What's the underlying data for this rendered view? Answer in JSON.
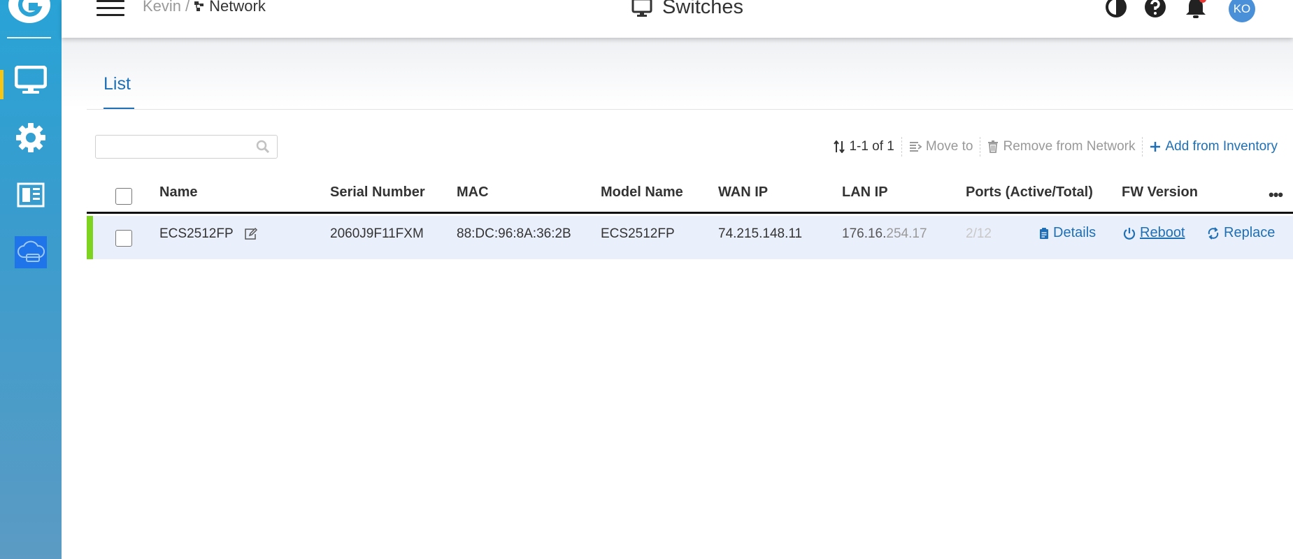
{
  "header": {
    "breadcrumb_parent": "Kevin",
    "breadcrumb_separator": "/",
    "breadcrumb_current": "Network",
    "title": "Switches",
    "avatar_initials": "KO"
  },
  "tabs": [
    {
      "label": "List",
      "active": true
    }
  ],
  "search": {
    "value": "",
    "placeholder": ""
  },
  "toolbar": {
    "count": "1-1 of 1",
    "move_to": "Move to",
    "remove": "Remove from Network",
    "add": "Add from Inventory"
  },
  "table": {
    "columns": [
      "Name",
      "Serial Number",
      "MAC",
      "Model Name",
      "WAN IP",
      "LAN IP",
      "Ports (Active/Total)",
      "FW Version"
    ],
    "rows": [
      {
        "name": "ECS2512FP",
        "serial": "2060J9F11FXM",
        "mac": "88:DC:96:8A:36:2B",
        "model": "ECS2512FP",
        "wan_ip": "74.215.148.11",
        "lan_ip_a": "176.16.",
        "lan_ip_b": "254.17",
        "ports": "2/12",
        "status": "online",
        "actions": {
          "details": "Details",
          "reboot": "Reboot",
          "replace": "Replace"
        }
      }
    ]
  },
  "colors": {
    "accent": "#1e6fb5",
    "status_online": "#7ed321",
    "sidebar_active": "#f5c518",
    "row_selected": "#e9effb"
  }
}
